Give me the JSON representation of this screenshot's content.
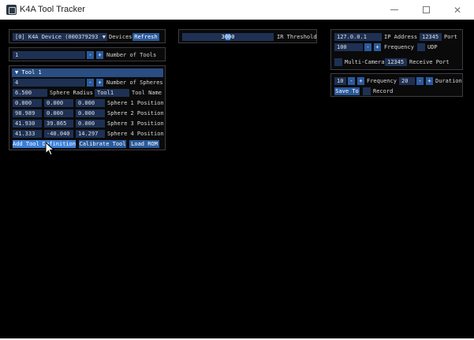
{
  "window": {
    "title": "K4A Tool Tracker"
  },
  "device": {
    "selected": "[0] K4A Device (000379293",
    "label": "Devices",
    "refresh": "Refresh"
  },
  "tools": {
    "count": "1",
    "label": "Number of Tools",
    "minus": "-",
    "plus": "+"
  },
  "tool1": {
    "header": "▼ Tool 1",
    "spheres_count": "4",
    "spheres_label": "Number of Spheres",
    "radius": "6.500",
    "radius_label": "Sphere Radius",
    "name": "Tool1",
    "name_label": "Tool Name",
    "positions": [
      {
        "x": "0.000",
        "y": "0.000",
        "z": "0.000",
        "label": "Sphere 1 Position"
      },
      {
        "x": "98.989",
        "y": "0.000",
        "z": "0.000",
        "label": "Sphere 2 Position"
      },
      {
        "x": "41.930",
        "y": "39.865",
        "z": "0.000",
        "label": "Sphere 3 Position"
      },
      {
        "x": "41.333",
        "y": "-40.040",
        "z": "14.297",
        "label": "Sphere 4 Position"
      }
    ],
    "add_btn": "Add Tool Definition",
    "calibrate_btn": "Calibrate Tool",
    "load_btn": "Load ROM"
  },
  "ir": {
    "value": "3000",
    "label": "IR Threshold",
    "level": 0.5
  },
  "network": {
    "ip": "127.0.0.1",
    "ip_label": "IP Address",
    "port": "12345",
    "port_label": "Port",
    "freq": "100",
    "freq_label": "Frequency",
    "udp_label": "UDP",
    "multicam_label": "Multi-Camera",
    "recv_port": "12345",
    "recv_label": "Receive Port"
  },
  "record": {
    "freq": "10",
    "freq_label": "Frequency",
    "duration": "20",
    "duration_label": "Duration",
    "save_btn": "Save To",
    "record_label": "Record"
  }
}
